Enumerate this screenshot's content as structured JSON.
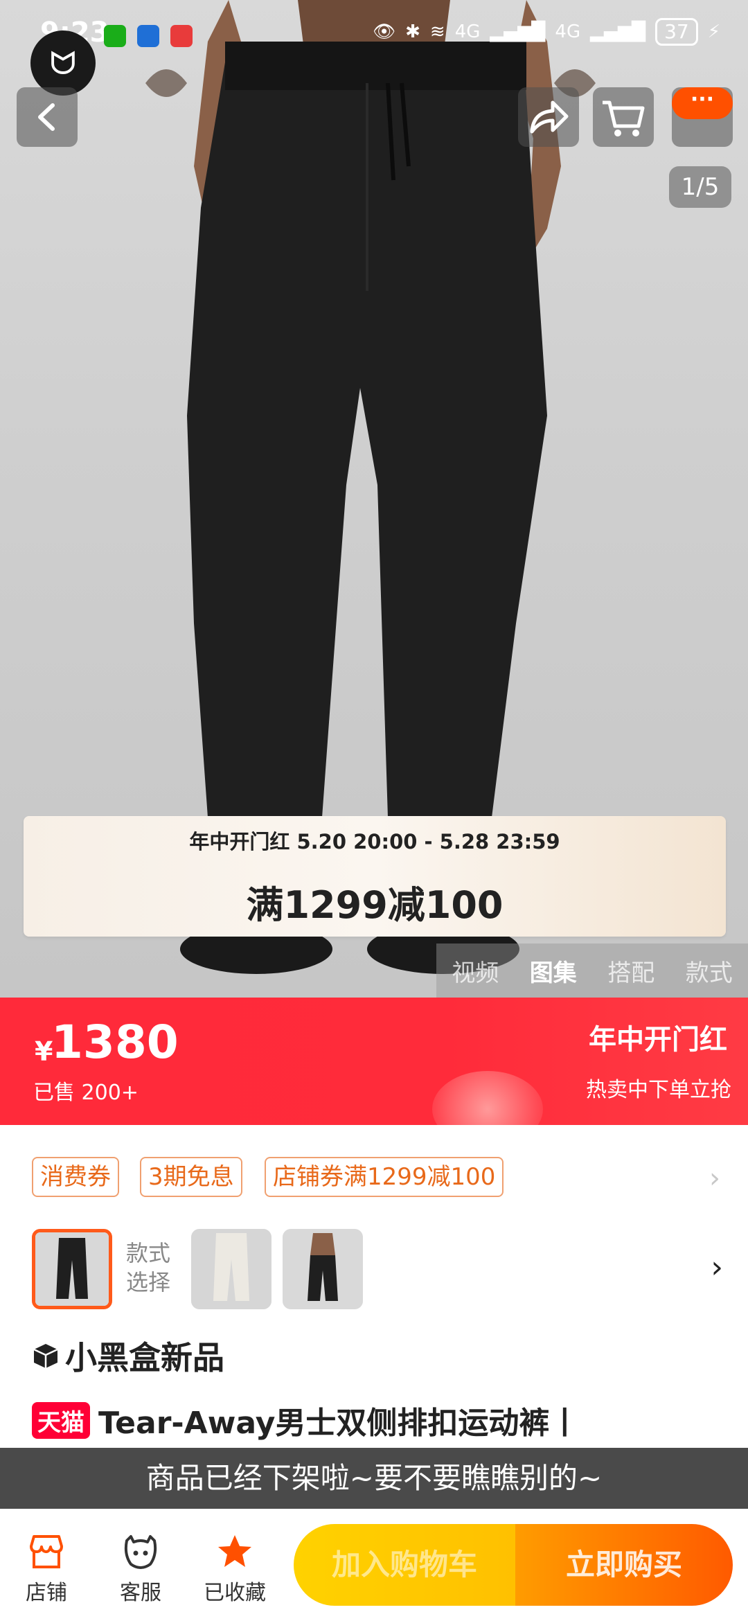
{
  "status_bar": {
    "time": "9:23",
    "network_left": "4G",
    "network_right": "4G",
    "battery": "37"
  },
  "gallery": {
    "counter": "1/5",
    "tabs": [
      "视频",
      "图集",
      "搭配",
      "款式"
    ],
    "active_tab": "图集"
  },
  "promo_banner": {
    "period": "年中开门红  5.20 20:00 - 5.28 23:59",
    "deal": "满1299减100"
  },
  "price_bar": {
    "currency": "¥",
    "price": "1380",
    "sold": "已售 200+",
    "event_title": "年中开门红",
    "event_sub": "热卖中下单立抢"
  },
  "coupons": [
    "消费券",
    "3期免息",
    "店铺券满1299减100"
  ],
  "sku_selector": {
    "label": "款式选择"
  },
  "product": {
    "tag": "小黑盒新品",
    "platform_badge": "天猫",
    "title": "Tear-Away男士双侧排扣运动裤丨"
  },
  "toast": "商品已经下架啦~要不要瞧瞧别的~",
  "bottom_nav": {
    "store": "店铺",
    "service": "客服",
    "favorited": "已收藏",
    "add_to_cart": "加入购物车",
    "buy_now": "立即购买"
  },
  "colors": {
    "price_red": "#ff2a3a",
    "accent_orange": "#ff5000",
    "coupon_orange": "#e8691a",
    "tmall_red": "#ff0036"
  }
}
